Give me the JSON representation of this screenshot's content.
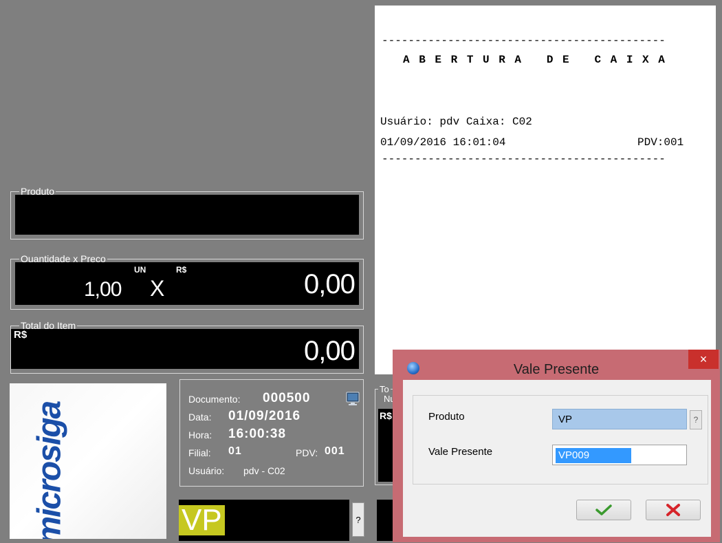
{
  "receipt": {
    "rule1": "-------------------------------------------",
    "heading": "A B E R T U R A   D E   C A I X A",
    "user_line": "Usuário: pdv Caixa: C02",
    "datetime": "01/09/2016 16:01:04",
    "pdv": "PDV:001",
    "rule2": "-------------------------------------------"
  },
  "produto_group": {
    "title": "Produto",
    "value": ""
  },
  "quantidade_group": {
    "title": "Quantidade x Preco",
    "quantity": "1,00",
    "unit": "UN",
    "times": "X",
    "currency": "R$",
    "price": "0,00"
  },
  "total_item_group": {
    "title": "Total do Item",
    "currency": "R$",
    "value": "0,00"
  },
  "logo": {
    "text": "microsiga"
  },
  "info": {
    "documento_label": "Documento:",
    "documento_value": "000500",
    "data_label": "Data:",
    "data_value": "01/09/2016",
    "hora_label": "Hora:",
    "hora_value": "16:00:38",
    "filial_label": "Filial:",
    "filial_value": "01",
    "pdv_label": "PDV:",
    "pdv_value": "001",
    "usuario_label": "Usuário:",
    "usuario_value": "pdv - C02"
  },
  "total_group": {
    "title_partial": "To",
    "sub_partial": "Nu",
    "currency_partial": "R$"
  },
  "command_field": {
    "value": "VP",
    "help": "?"
  },
  "dialog": {
    "title": "Vale Presente",
    "close": "×",
    "produto_label": "Produto",
    "produto_value": "VP",
    "produto_help": "?",
    "vale_label": "Vale Presente",
    "vale_value": "VP009",
    "ok_icon": "checkmark-icon",
    "cancel_icon": "x-icon",
    "colors": {
      "titlebar": "#c76b73",
      "close": "#c9302c",
      "highlight": "#3399ff"
    }
  }
}
